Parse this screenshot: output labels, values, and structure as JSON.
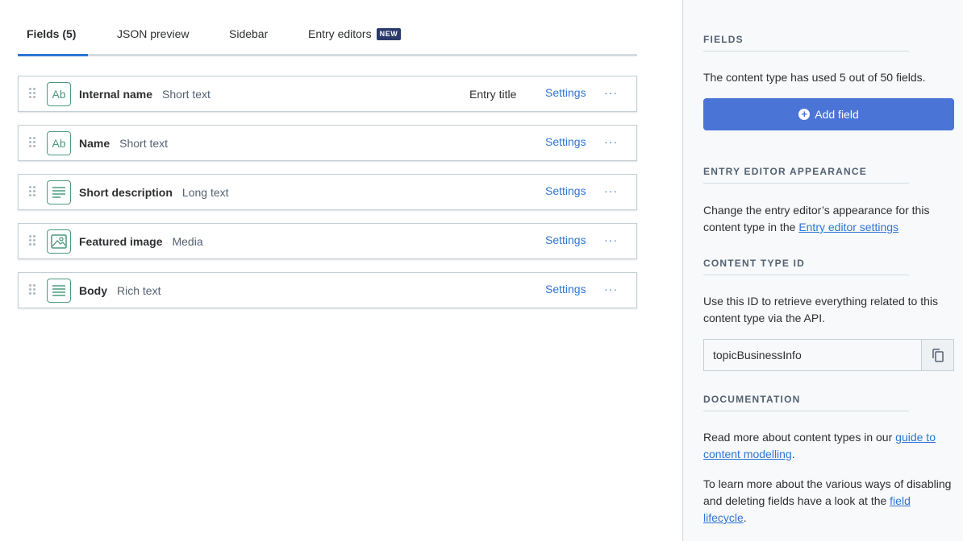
{
  "tabs": [
    {
      "label": "Fields (5)",
      "active": true
    },
    {
      "label": "JSON preview",
      "active": false
    },
    {
      "label": "Sidebar",
      "active": false
    },
    {
      "label": "Entry editors",
      "active": false,
      "badge": "NEW"
    }
  ],
  "fields": [
    {
      "name": "Internal name",
      "type": "Short text",
      "icon": "short-text-icon",
      "note": "Entry title"
    },
    {
      "name": "Name",
      "type": "Short text",
      "icon": "short-text-icon"
    },
    {
      "name": "Short description",
      "type": "Long text",
      "icon": "long-text-icon"
    },
    {
      "name": "Featured image",
      "type": "Media",
      "icon": "media-icon"
    },
    {
      "name": "Body",
      "type": "Rich text",
      "icon": "rich-text-icon"
    }
  ],
  "row_actions": {
    "settings": "Settings",
    "more": "···"
  },
  "sidebar": {
    "fields": {
      "heading": "FIELDS",
      "text": "The content type has used 5 out of 50 fields.",
      "add_button": "Add field"
    },
    "appearance": {
      "heading": "ENTRY EDITOR APPEARANCE",
      "text": "Change the entry editor’s appearance for this content type in the",
      "link": "Entry editor settings"
    },
    "content_type_id": {
      "heading": "CONTENT TYPE ID",
      "text": "Use this ID to retrieve everything related to this content type via the API.",
      "value": "topicBusinessInfo"
    },
    "documentation": {
      "heading": "DOCUMENTATION",
      "text1": "Read more about content types in our",
      "link1": "guide to content modelling",
      "text2": "To learn more about the various ways of disabling and deleting fields have a look at the",
      "link2": "field lifecycle"
    }
  },
  "colors": {
    "accent": "#2e75d4",
    "button": "#4a74d6",
    "field_icon": "#4b9a7d",
    "badge": "#2a3a6b"
  }
}
